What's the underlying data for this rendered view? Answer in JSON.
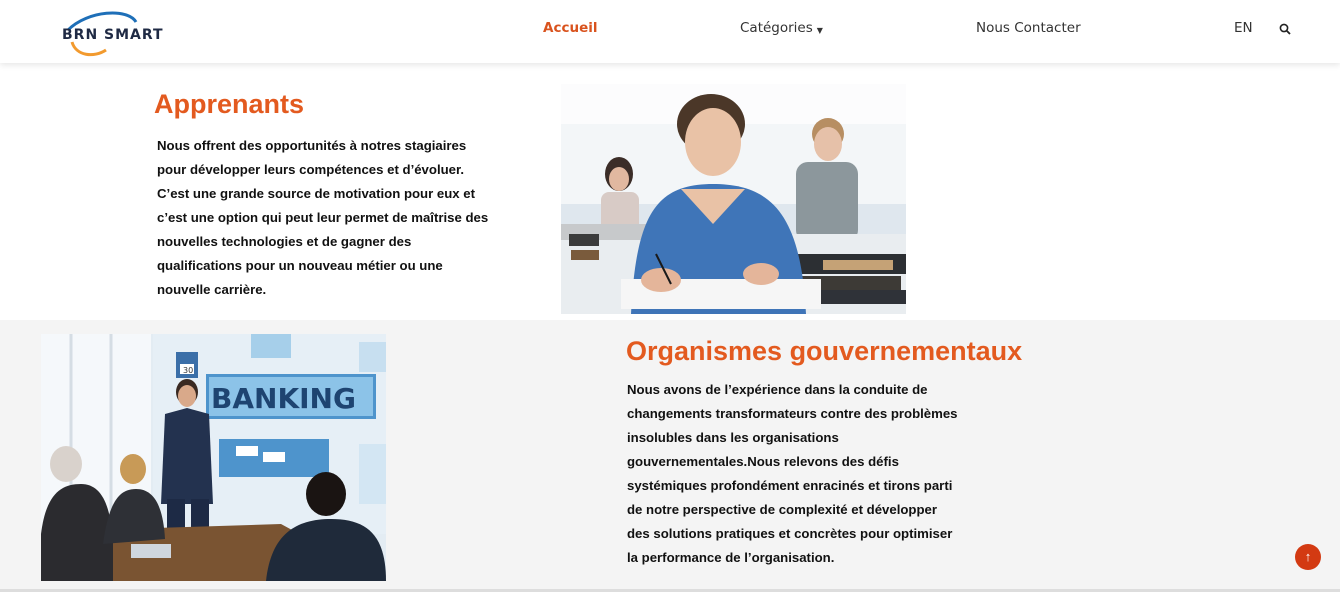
{
  "header": {
    "logo_text": "BRN SMART",
    "nav": {
      "home": "Accueil",
      "categories": "Catégories",
      "contact": "Nous Contacter",
      "language": "EN"
    }
  },
  "learners": {
    "title": "Apprenants",
    "lines": [
      "Nous offrent des opportunités à notres stagiaires",
      "pour développer leurs compétences et d’évoluer.",
      "C’est une grande source de motivation pour eux et",
      "c’est une option qui peut leur permet de maîtrise des",
      "nouvelles technologies et de gagner des",
      "qualifications pour un nouveau métier ou une",
      "nouvelle carrière."
    ]
  },
  "government": {
    "title": "Organismes gouvernementaux",
    "image_text": "BANKING",
    "calendar_number": "30",
    "lines": [
      "Nous avons de l’expérience dans la conduite de",
      "changements transformateurs contre des problèmes",
      "insolubles dans les organisations",
      "gouvernementales.Nous relevons des défis",
      "systémiques profondément enracinés et tirons parti",
      "de notre perspective de complexité et développer",
      "des solutions pratiques et concrètes pour optimiser",
      "la performance de l’organisation."
    ]
  },
  "colors": {
    "accent": "#e35a1f",
    "scroll_button": "#d33a12",
    "section_bg": "#f4f4f4"
  },
  "icons": {
    "search": "search-icon",
    "caret": "caret-down-icon",
    "scroll_top": "arrow-up-icon"
  }
}
